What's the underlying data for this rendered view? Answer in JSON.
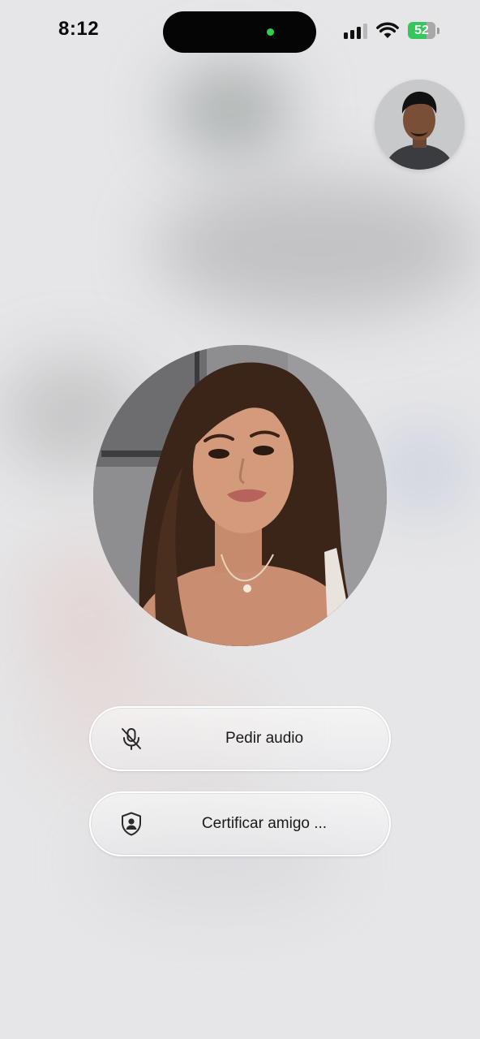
{
  "status_bar": {
    "time": "8:12",
    "battery": "52",
    "signal_icon": "cellular-signal-icon",
    "wifi_icon": "wifi-icon",
    "battery_icon": "battery-charging-icon",
    "camera_indicator_color": "#32d04a",
    "battery_color": "#34c759"
  },
  "call": {
    "self_view": "self-view-avatar",
    "caller_photo": "caller-photo"
  },
  "actions": [
    {
      "label": "Pedir audio",
      "icon": "mic-off-icon"
    },
    {
      "label": "Certificar amigo ...",
      "icon": "shield-person-icon"
    }
  ]
}
